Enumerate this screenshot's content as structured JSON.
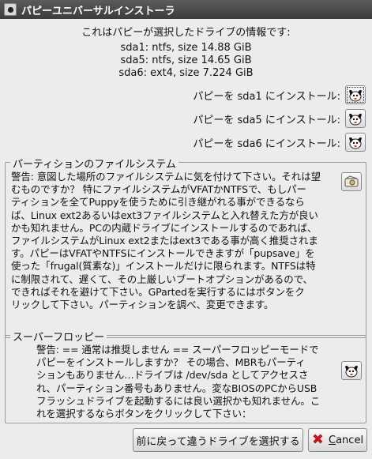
{
  "window": {
    "title": "パピーユニバーサルインストーラ"
  },
  "info": {
    "heading": "これはパピーが選択したドライブの情報です:",
    "drives": [
      "sda1: ntfs, size 14.88 GiB",
      "sda5: ntfs, size 14.65 GiB",
      "sda6: ext4, size 7.224 GiB"
    ]
  },
  "install_options": [
    {
      "label": "パピーを  sda1 にインストール:",
      "icon": "puppy-icon"
    },
    {
      "label": "パピーを  sda5 にインストール:",
      "icon": "puppy-icon"
    },
    {
      "label": "パピーを  sda6 にインストール:",
      "icon": "puppy-icon"
    }
  ],
  "partition_fs": {
    "title": "パーティションのファイルシステム",
    "lines": [
      "警告: 意図した場所のファイルシステムに気を付けて下さい。それは望",
      "むものですか？ 特にファイルシステムがVFATかNTFSで、もしパー",
      "ティションを全てPuppyを使うために引き継がれる事ができるなら",
      "ば、Linux ext2あるいはext3ファイルシステムと入れ替えた方が良い",
      "かも知れません。PCの内蔵ドライブにインストールするのであれば、",
      "ファイルシステムがLinux ext2またはext3である事が高く推奨されま",
      "す。パピーはVFATやNTFSにインストールできますが「pupsave」を",
      "使った「frugal(質素な)」インストールだけに限られます。NTFSは特",
      "に制限されて、遅くて、その上厳しいブートオプションがあるので、",
      "できればそれを避けて下さい。GPartedを実行するにはボタンをク",
      "リックして下さい。パーティションを調べ、変更できます。"
    ],
    "button_icon": "gparted-icon"
  },
  "super_floppy": {
    "title": "スーパーフロッピー",
    "lines": [
      "警告: == 通常は推奨しません == スーパーフロッピーモードで",
      "パピーをインストールしますか？ その場合、MBRもパーティ",
      "ションもありません…ドライブは /dev/sda としてアクセスさ",
      "れ、パーティション番号もありません。変なBIOSのPCからUSB",
      "フラッシュドライブを起動するには良い選択かも知れません。こ",
      "れを選択するならボタンをクリックして下さい："
    ],
    "button_icon": "puppy-icon"
  },
  "buttons": {
    "back": "前に戻って違うドライブを選択する",
    "cancel_accel": "C",
    "cancel_rest": "ancel"
  },
  "colors": {
    "cancel_icon": "#c8141c",
    "titlebar": "#4a4a4a",
    "background": "#ececea"
  }
}
